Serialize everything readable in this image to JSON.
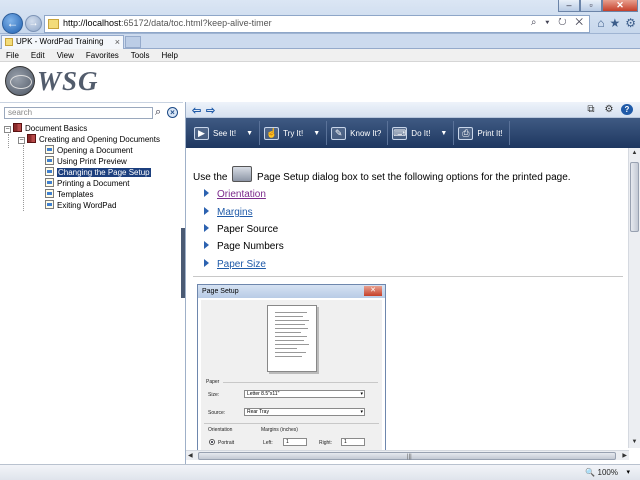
{
  "browser": {
    "address_host": "http://localhost",
    "address_rest": ":65172/data/toc.html?keep-alive-timer",
    "address_tools": "⌕ ▾ ↻ ✕",
    "tab_title": "UPK - WordPad Training",
    "tab_close": "×",
    "window_controls": [
      "–",
      "▫",
      "✕"
    ],
    "nav_back": "←",
    "nav_forward": "→",
    "right_icons": [
      "⌂",
      "★",
      "⚙"
    ]
  },
  "menu": [
    "File",
    "Edit",
    "View",
    "Favorites",
    "Tools",
    "Help"
  ],
  "header": {
    "logo_text": "WSG"
  },
  "toc": {
    "search_placeholder": "search",
    "search_go": "⌕",
    "search_clear": "×",
    "root": {
      "expander": "−",
      "label": "Document Basics"
    },
    "section": {
      "expander": "−",
      "label": "Creating and Opening Documents"
    },
    "items": [
      {
        "label": "Opening a Document",
        "selected": false
      },
      {
        "label": "Using Print Preview",
        "selected": false
      },
      {
        "label": "Changing the Page Setup",
        "selected": true
      },
      {
        "label": "Printing a Document",
        "selected": false
      },
      {
        "label": "Templates",
        "selected": false
      },
      {
        "label": "Exiting WordPad",
        "selected": false
      }
    ]
  },
  "subtoolbar": {
    "back": "⇦",
    "forward": "⇨",
    "icons": [
      "⧉",
      "⚙",
      "?"
    ]
  },
  "modes": [
    {
      "label": "See It!",
      "icon": "▶",
      "dropdown": true
    },
    {
      "label": "Try It!",
      "icon": "☝",
      "dropdown": true
    },
    {
      "label": "Know It?",
      "icon": "✎",
      "dropdown": false
    },
    {
      "label": "Do It!",
      "icon": "⌨",
      "dropdown": true
    },
    {
      "label": "Print It!",
      "icon": "⎙",
      "dropdown": false
    }
  ],
  "dropdown_arrow": "▼",
  "content": {
    "intro_before": "Use the",
    "intro_after": "Page Setup dialog box to set the following options for the printed page.",
    "options": [
      {
        "label": "Orientation",
        "link": true,
        "visited": true
      },
      {
        "label": "Margins",
        "link": true,
        "visited": false
      },
      {
        "label": "Paper Source",
        "link": false,
        "visited": false
      },
      {
        "label": "Page Numbers",
        "link": false,
        "visited": false
      },
      {
        "label": "Paper Size",
        "link": true,
        "visited": false
      }
    ]
  },
  "dialog": {
    "title": "Page Setup",
    "close": "✕",
    "paper_group": "Paper",
    "size_label": "Size:",
    "size_value": "Letter 8.5\"x11\"",
    "source_label": "Source:",
    "source_value": "Rear Tray",
    "orientation_group": "Orientation",
    "margins_group": "Margins (inches)",
    "portrait_label": "Portrait",
    "left_label": "Left:",
    "left_value": "1",
    "right_label": "Right:",
    "right_value": "1"
  },
  "scroll": {
    "up": "▲",
    "down": "▼",
    "left": "◀",
    "right": "▶",
    "grip": "|||"
  },
  "status": {
    "zoom": "100%",
    "zoom_dropdown": "▾",
    "zoom_icon": "🔍"
  },
  "colors": {
    "selection": "#1c3f7e",
    "link": "#1f5aa8",
    "visited_link": "#7b2a8c",
    "modebar": "#1e3760"
  }
}
